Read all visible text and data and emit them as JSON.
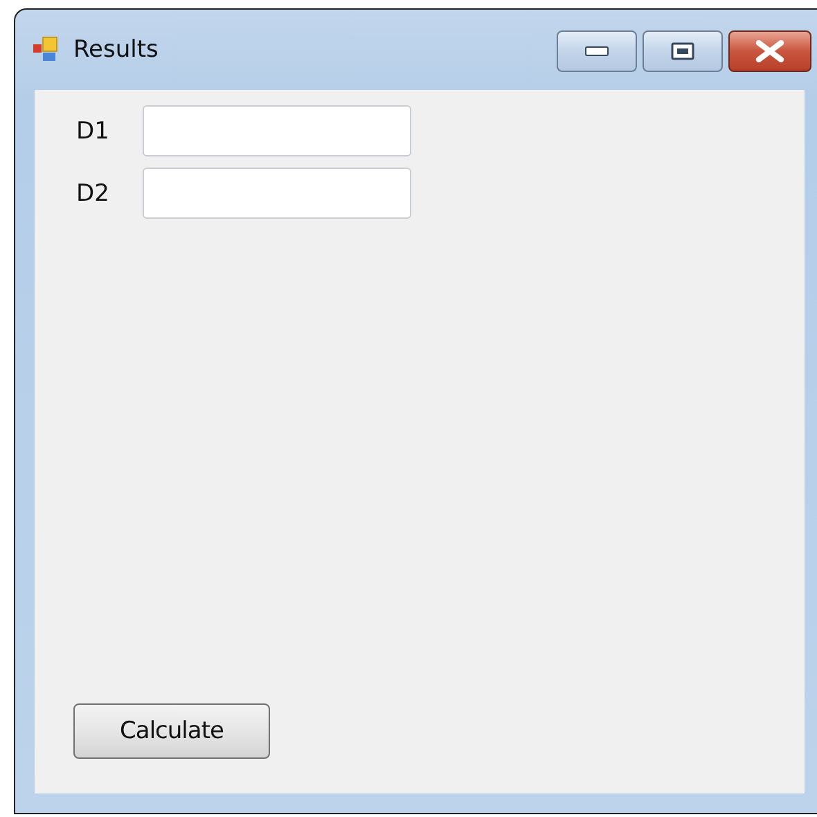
{
  "window": {
    "title": "Results"
  },
  "fields": [
    {
      "label": "D1"
    },
    {
      "label": "D2"
    }
  ],
  "buttons": [
    "Calculate"
  ]
}
